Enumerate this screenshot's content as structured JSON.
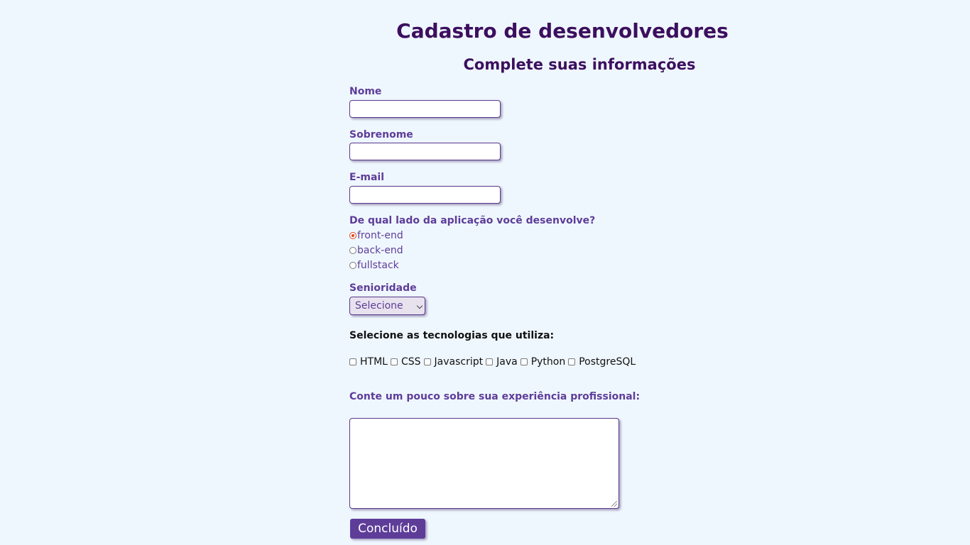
{
  "header": {
    "title": "Cadastro de desenvolvedores",
    "subtitle": "Complete suas informações"
  },
  "form": {
    "name_label": "Nome",
    "name_value": "",
    "surname_label": "Sobrenome",
    "surname_value": "",
    "email_label": "E-mail",
    "email_value": "",
    "side_question": "De qual lado da aplicação você desenvolve?",
    "side_options": [
      {
        "label": "front-end",
        "checked": true
      },
      {
        "label": "back-end",
        "checked": false
      },
      {
        "label": "fullstack",
        "checked": false
      }
    ],
    "seniority_label": "Senioridade",
    "seniority_selected": "Selecione",
    "tech_label": "Selecione as tecnologias que utiliza:",
    "technologies": [
      {
        "label": "HTML",
        "checked": false
      },
      {
        "label": "CSS",
        "checked": false
      },
      {
        "label": "Javascript",
        "checked": false
      },
      {
        "label": "Java",
        "checked": false
      },
      {
        "label": "Python",
        "checked": false
      },
      {
        "label": "PostgreSQL",
        "checked": false
      }
    ],
    "experience_label": "Conte um pouco sobre sua experiência profissional:",
    "experience_value": "",
    "submit_label": "Concluído"
  },
  "colors": {
    "background": "#eff7fe",
    "heading": "#3c0f5e",
    "label": "#5e3d99",
    "button": "#5e3d99",
    "radio_checked": "#e0461c"
  }
}
